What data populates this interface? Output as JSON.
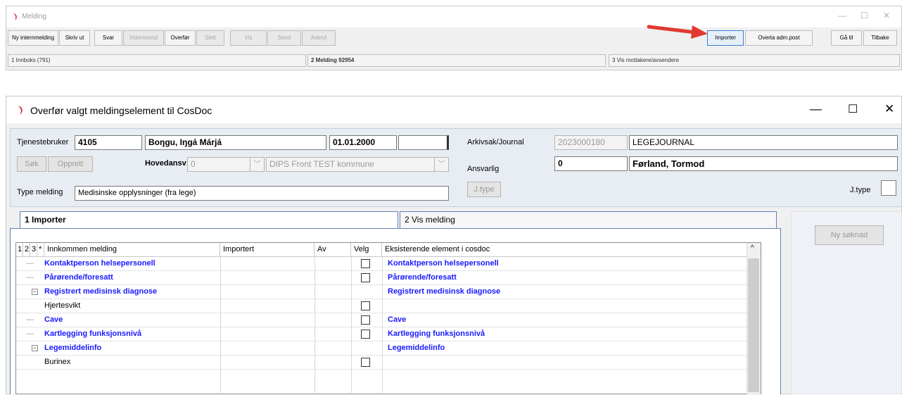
{
  "top_window": {
    "title": "Melding",
    "controls": {
      "minimize": "—",
      "maximize": "☐",
      "close": "✕"
    },
    "toolbar": [
      {
        "label": "Ny internmelding",
        "enabled": true
      },
      {
        "label": "Skriv ut",
        "enabled": true
      },
      {
        "label": "Svar",
        "enabled": true
      },
      {
        "label": "Videresend",
        "enabled": false
      },
      {
        "label": "Overfør",
        "enabled": true
      },
      {
        "label": "Slett",
        "enabled": false
      },
      {
        "label": "Vis",
        "enabled": false
      },
      {
        "label": "Send",
        "enabled": false
      },
      {
        "label": "Avbryt",
        "enabled": false
      },
      {
        "label": "Importer",
        "enabled": true
      },
      {
        "label": "Overta adm.post",
        "enabled": true
      },
      {
        "label": "Gå til",
        "enabled": true
      },
      {
        "label": "Tilbake",
        "enabled": true
      }
    ],
    "status": [
      "1 Innboks (791)",
      "2 Melding  92954",
      "3 Vis mottakere/avsendere"
    ]
  },
  "dialog": {
    "title": "Overfør valgt meldingselement til CosDoc",
    "controls": {
      "minimize": "—",
      "maximize": "☐",
      "close": "✕"
    },
    "tjenestebruker_label": "Tjenestebruker",
    "tjenestebruker_id": "4105",
    "tjenestebruker_name": "Boŋgu, Iŋgá Márjá",
    "tjenestebruker_dob": "01.01.2000",
    "sok_button": "Søk",
    "opprett_button": "Opprett",
    "hovedansv_label": "Hovedansv:",
    "hovedansv_value": "0",
    "hovedansv_org": "DIPS Front TEST kommune",
    "type_melding_label": "Type melding",
    "type_melding_value": "Medisinske opplysninger (fra lege)",
    "arkivsak_label": "Arkivsak/Journal",
    "arkivsak_number": "2023000180",
    "arkivsak_name": "LEGEJOURNAL",
    "ansvarlig_label": "Ansvarlig",
    "ansvarlig_id": "0",
    "ansvarlig_name": "Førland, Tormod",
    "jtype_button": "J.type",
    "jtype_label": "J.type",
    "tabs": [
      "1 Importer",
      "2 Vis melding"
    ],
    "ny_soknad_button": "Ny søknad",
    "grid": {
      "headers": [
        "1",
        "2",
        "3",
        "*",
        "Innkommen melding",
        "Importert",
        "Av",
        "Velg",
        "Eksisterende element i cosdoc"
      ],
      "rows": [
        {
          "name": "Kontaktperson helsepersonell",
          "bold": true,
          "expander": false,
          "checkbox": true,
          "existing": "Kontaktperson helsepersonell",
          "indent": 0
        },
        {
          "name": "Pårørende/foresatt",
          "bold": true,
          "expander": false,
          "checkbox": true,
          "existing": "Pårørende/foresatt",
          "indent": 0
        },
        {
          "name": "Registrert medisinsk diagnose",
          "bold": true,
          "expander": true,
          "checkbox": false,
          "existing": "Registrert medisinsk diagnose",
          "indent": 0
        },
        {
          "name": "Hjertesvikt",
          "bold": false,
          "expander": false,
          "checkbox": true,
          "existing": "",
          "indent": 1
        },
        {
          "name": "Cave",
          "bold": true,
          "expander": false,
          "checkbox": true,
          "existing": "Cave",
          "indent": 0
        },
        {
          "name": "Kartlegging funksjonsnivå",
          "bold": true,
          "expander": false,
          "checkbox": true,
          "existing": "Kartlegging funksjonsnivå",
          "indent": 0
        },
        {
          "name": "Legemiddelinfo",
          "bold": true,
          "expander": true,
          "checkbox": false,
          "existing": "Legemiddelinfo",
          "indent": 0
        },
        {
          "name": "Burinex",
          "bold": false,
          "expander": false,
          "checkbox": true,
          "existing": "",
          "indent": 1
        }
      ]
    }
  },
  "colors": {
    "link_blue": "#1a1aff",
    "arrow_red": "#e03a2f",
    "highlight": "#3c7fd6"
  }
}
